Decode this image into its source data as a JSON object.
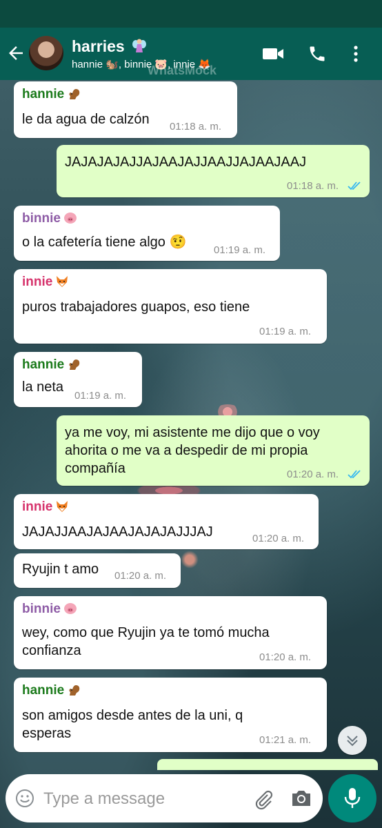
{
  "header": {
    "title": "harries",
    "subtitle": "hannie 🐿️, binnie 🐷, innie 🦊",
    "watermark": "WhatsMock",
    "title_emoji": "fairy-icon"
  },
  "messages": [
    {
      "dir": "in",
      "sender": "hannie",
      "sender_icon": "squirrel-icon",
      "sender_color": "#1b7a1b",
      "text": [
        "le da agua de calzón"
      ],
      "time": "01:18 a. m."
    },
    {
      "dir": "out",
      "text": [
        "JAJAJAJAJJAJAAJAJJAAJJAJAAJAAJ"
      ],
      "time": "01:18 a. m."
    },
    {
      "dir": "in",
      "sender": "binnie",
      "sender_icon": "pig-icon",
      "sender_color": "#8e5ca6",
      "text": [
        "o la cafetería tiene algo 🤨"
      ],
      "time": "01:19 a. m."
    },
    {
      "dir": "in",
      "sender": "innie",
      "sender_icon": "fox-icon",
      "sender_color": "#d6336c",
      "text": [
        "puros trabajadores guapos, eso tiene"
      ],
      "time": "01:19 a. m."
    },
    {
      "dir": "in",
      "sender": "hannie",
      "sender_icon": "squirrel-icon",
      "sender_color": "#1b7a1b",
      "text": [
        "la neta"
      ],
      "time": "01:19 a. m."
    },
    {
      "dir": "out",
      "text": [
        "ya me voy, mi asistente me dijo que o voy",
        "ahorita o me va a despedir de mi propia",
        "compañía"
      ],
      "time": "01:20 a. m."
    },
    {
      "dir": "in",
      "sender": "innie",
      "sender_icon": "fox-icon",
      "sender_color": "#d6336c",
      "text": [
        "JAJAJJAAJAJAAJAJAJAJJJAJ"
      ],
      "time": "01:20 a. m."
    },
    {
      "dir": "in",
      "text": [
        "Ryujin t amo"
      ],
      "time": "01:20 a. m."
    },
    {
      "dir": "in",
      "sender": "binnie",
      "sender_icon": "pig-icon",
      "sender_color": "#8e5ca6",
      "text": [
        "wey, como que Ryujin ya te tomó mucha",
        "confianza"
      ],
      "time": "01:20 a. m."
    },
    {
      "dir": "in",
      "sender": "hannie",
      "sender_icon": "squirrel-icon",
      "sender_color": "#1b7a1b",
      "text": [
        "son amigos desde antes de la uni, q",
        "esperas"
      ],
      "time": "01:21 a. m."
    }
  ],
  "input": {
    "placeholder": "Type a message"
  },
  "colors": {
    "header": "#075e54",
    "status": "#0c4a3f",
    "outgoing": "#e1ffc7",
    "incoming": "#ffffff",
    "read_tick": "#34b7f1",
    "mic": "#00897b"
  }
}
